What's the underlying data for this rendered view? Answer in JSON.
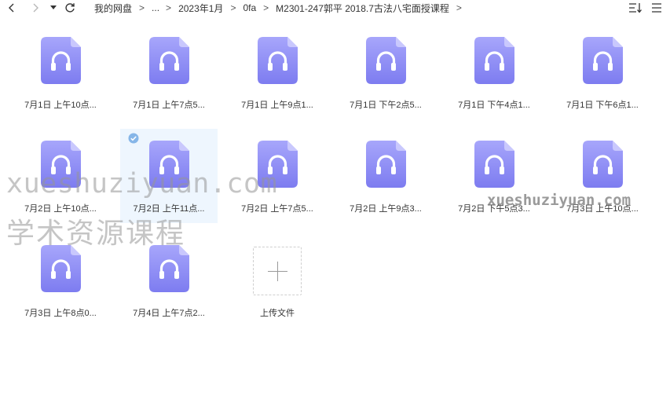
{
  "toolbar": {
    "back_icon": "chevron-left-icon",
    "forward_icon": "chevron-right-icon",
    "dropdown_icon": "caret-down-icon",
    "refresh_icon": "refresh-icon",
    "sort_icon": "sort-icon",
    "more_icon": "more-icon"
  },
  "breadcrumb": {
    "items": [
      "我的网盘",
      "...",
      "2023年1月",
      "0fa",
      "M2301-247郭平 2018.7古法八宅面授课程"
    ],
    "separator": ">"
  },
  "files": [
    {
      "name": "7月1日 上午10点..."
    },
    {
      "name": "7月1日 上午7点5..."
    },
    {
      "name": "7月1日 上午9点1..."
    },
    {
      "name": "7月1日 下午2点5..."
    },
    {
      "name": "7月1日 下午4点1..."
    },
    {
      "name": "7月1日 下午6点1..."
    },
    {
      "name": "7月2日 上午10点..."
    },
    {
      "name": "7月2日 上午11点...",
      "selected": true
    },
    {
      "name": "7月2日 上午7点5..."
    },
    {
      "name": "7月2日 上午9点3..."
    },
    {
      "name": "7月2日 下午5点3..."
    },
    {
      "name": "7月3日 上午10点..."
    },
    {
      "name": "7月3日 上午8点0..."
    },
    {
      "name": "7月4日 上午7点2..."
    }
  ],
  "upload": {
    "label": "上传文件"
  },
  "colors": {
    "icon_top": "#a7a6fb",
    "icon_bottom": "#7d7cf0",
    "icon_fold": "#c9c8fd",
    "selected_bg": "#eef6fe",
    "check": "#86b6e8"
  },
  "watermarks": [
    "xueshuziyuan.com",
    "学术资源课程",
    "xueshuziyuan.com"
  ]
}
